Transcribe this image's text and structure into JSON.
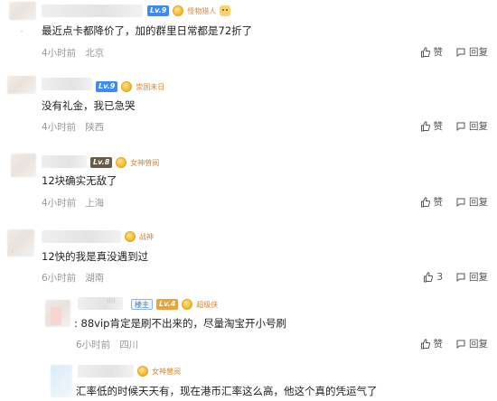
{
  "comments": [
    {
      "level": "Lv.9",
      "medal": "怪物猎人",
      "text": "最近点卡都降价了，加的群里日常都是72折了",
      "time": "4小时前",
      "location": "北京",
      "like_label": "赞",
      "reply_label": "回复"
    },
    {
      "level": "Lv.9",
      "medal": "崇国未日",
      "text": "没有礼金，我已急哭",
      "time": "4小时前",
      "location": "陕西",
      "like_label": "赞",
      "reply_label": "回复"
    },
    {
      "level": "Lv.8",
      "medal": "女神曾阅",
      "text": "12块确实无敌了",
      "time": "4小时前",
      "location": "上海",
      "like_label": "赞",
      "reply_label": "回复"
    },
    {
      "medal": "战神",
      "text": "12快的我是真没遇到过",
      "time": "6小时前",
      "location": "湖南",
      "like_count": "3",
      "reply_label": "回复"
    },
    {
      "name_suffix": "IIII",
      "tag": "楼主",
      "level": "Lv.4",
      "medal": "超级侠",
      "text": ": 88vip肯定是刷不出来的，尽量淘宝开小号刷",
      "time": "6小时前",
      "location": "四川",
      "like_label": "赞",
      "reply_label": "回复"
    },
    {
      "medal": "女神曾阅",
      "text": "汇率低的时候天天有，现在港币汇率这么高，他这个真的凭运气了"
    }
  ],
  "icons": {
    "like": "thumb-up-icon",
    "reply": "speech-bubble-icon"
  }
}
